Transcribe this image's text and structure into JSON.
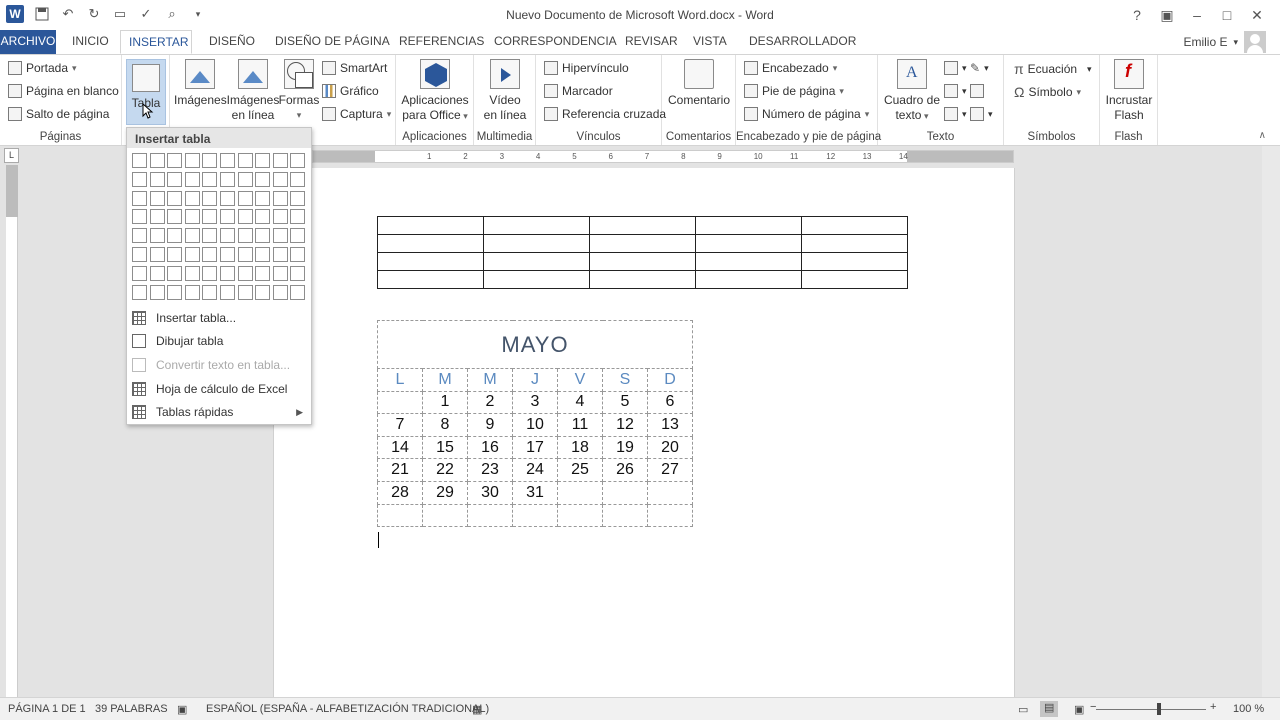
{
  "titlebar": {
    "title": "Nuevo Documento de Microsoft Word.docx - Word",
    "help": "?",
    "app_letter": "W"
  },
  "tabs": [
    "ARCHIVO",
    "INICIO",
    "INSERTAR",
    "DISEÑO",
    "DISEÑO DE PÁGINA",
    "REFERENCIAS",
    "CORRESPONDENCIA",
    "REVISAR",
    "VISTA",
    "DESARROLLADOR"
  ],
  "active_tab": "INSERTAR",
  "user": "Emilio E",
  "ribbon": {
    "paginas": {
      "label": "Páginas",
      "portada": "Portada",
      "blanco": "Página en blanco",
      "salto": "Salto de página"
    },
    "tablas": {
      "tabla": "Tabla"
    },
    "ilustraciones": {
      "imagenes": "Imágenes",
      "imagenes_linea_1": "Imágenes",
      "imagenes_linea_2": "en línea",
      "formas": "Formas",
      "smartart": "SmartArt",
      "grafico": "Gráfico",
      "captura": "Captura"
    },
    "aplicaciones": {
      "label": "Aplicaciones",
      "btn_1": "Aplicaciones",
      "btn_2": "para Office"
    },
    "multimedia": {
      "label": "Multimedia",
      "btn_1": "Vídeo",
      "btn_2": "en línea"
    },
    "vinculos": {
      "label": "Vínculos",
      "hipervinculo": "Hipervínculo",
      "marcador": "Marcador",
      "referencia": "Referencia cruzada"
    },
    "comentarios": {
      "label": "Comentarios",
      "btn": "Comentario"
    },
    "encabezado": {
      "label": "Encabezado y pie de página",
      "encabezado": "Encabezado",
      "pie": "Pie de página",
      "numero": "Número de página"
    },
    "texto": {
      "label": "Texto",
      "cuadro_1": "Cuadro de",
      "cuadro_2": "texto"
    },
    "simbolos": {
      "label": "Símbolos",
      "ecuacion": "Ecuación",
      "simbolo": "Símbolo"
    },
    "flash": {
      "label": "Flash",
      "btn_1": "Incrustar",
      "btn_2": "Flash"
    }
  },
  "table_menu": {
    "header": "Insertar tabla",
    "items": [
      {
        "label": "Insertar tabla...",
        "enabled": true
      },
      {
        "label": "Dibujar tabla",
        "enabled": true
      },
      {
        "label": "Convertir texto en tabla...",
        "enabled": false
      },
      {
        "label": "Hoja de cálculo de Excel",
        "enabled": true
      },
      {
        "label": "Tablas rápidas",
        "enabled": true
      }
    ]
  },
  "ruler_numbers": [
    "1",
    "2",
    "3",
    "4",
    "5",
    "6",
    "7",
    "8",
    "9",
    "10",
    "11",
    "12",
    "13",
    "14"
  ],
  "calendar": {
    "title": "MAYO",
    "days": [
      "L",
      "M",
      "M",
      "J",
      "V",
      "S",
      "D"
    ],
    "weeks": [
      [
        "",
        "1",
        "2",
        "3",
        "4",
        "5",
        "6"
      ],
      [
        "7",
        "8",
        "9",
        "10",
        "11",
        "12",
        "13"
      ],
      [
        "14",
        "15",
        "16",
        "17",
        "18",
        "19",
        "20"
      ],
      [
        "21",
        "22",
        "23",
        "24",
        "25",
        "26",
        "27"
      ],
      [
        "28",
        "29",
        "30",
        "31",
        "",
        "",
        ""
      ],
      [
        "",
        "",
        "",
        "",
        "",
        "",
        ""
      ]
    ]
  },
  "statusbar": {
    "page": "PÁGINA 1 DE 1",
    "words": "39 PALABRAS",
    "language": "ESPAÑOL (ESPAÑA - ALFABETIZACIÓN TRADICIONAL)",
    "zoom": "100 %",
    "zoom_level": 100
  },
  "colors": {
    "accent": "#2b579a",
    "day_header": "#5b8ac0",
    "title_text": "#44546a"
  }
}
